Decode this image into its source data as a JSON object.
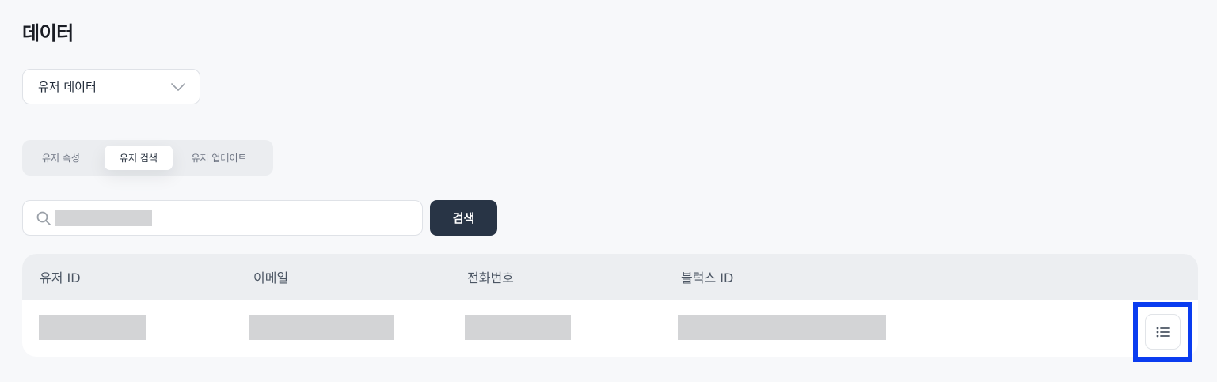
{
  "page": {
    "title": "데이터"
  },
  "dropdown": {
    "selected": "유저 데이터",
    "icon": "chevron-down-icon"
  },
  "tabs": [
    {
      "label": "유저 속성",
      "active": false
    },
    {
      "label": "유저 검색",
      "active": true
    },
    {
      "label": "유저 업데이트",
      "active": false
    }
  ],
  "search": {
    "value": "",
    "icon": "search-icon",
    "button_label": "검색"
  },
  "table": {
    "columns": [
      "유저 ID",
      "이메일",
      "전화번호",
      "블럭스 ID"
    ],
    "rows": [
      {
        "user_id": "",
        "email": "",
        "phone": "",
        "blux_id": "",
        "action_icon": "list-icon"
      }
    ]
  },
  "colors": {
    "primary_button": "#283445",
    "highlight": "#0a3cf0",
    "redacted": "#d3d4d6"
  }
}
